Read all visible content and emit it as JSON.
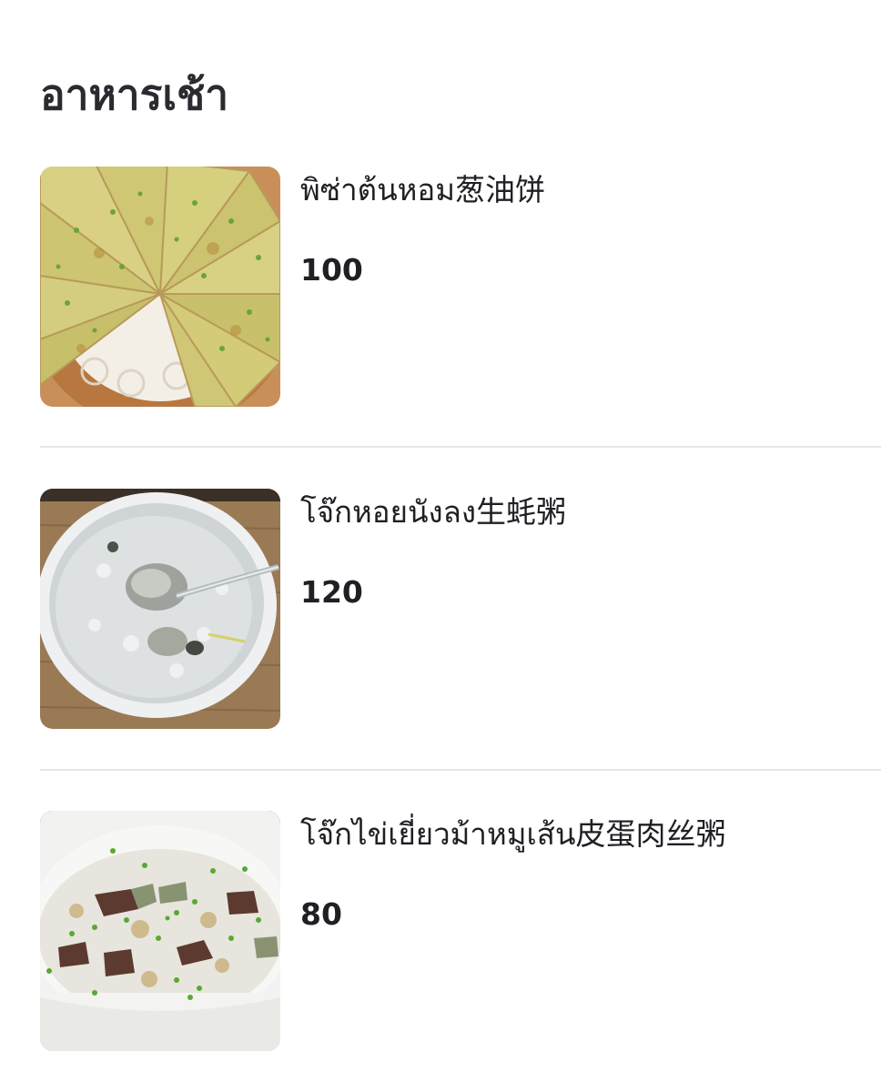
{
  "section": {
    "title": "อาหารเช้า"
  },
  "items": [
    {
      "name": "พิซ่าต้นหอม葱油饼",
      "price": "100",
      "image_icon": "scallion-pancake-photo"
    },
    {
      "name": "โจ๊กหอยนังลง生蚝粥",
      "price": "120",
      "image_icon": "oyster-congee-photo"
    },
    {
      "name": "โจ๊กไข่เยี่ยวม้าหมูเส้น皮蛋肉丝粥",
      "price": "80",
      "image_icon": "century-egg-congee-photo"
    }
  ]
}
